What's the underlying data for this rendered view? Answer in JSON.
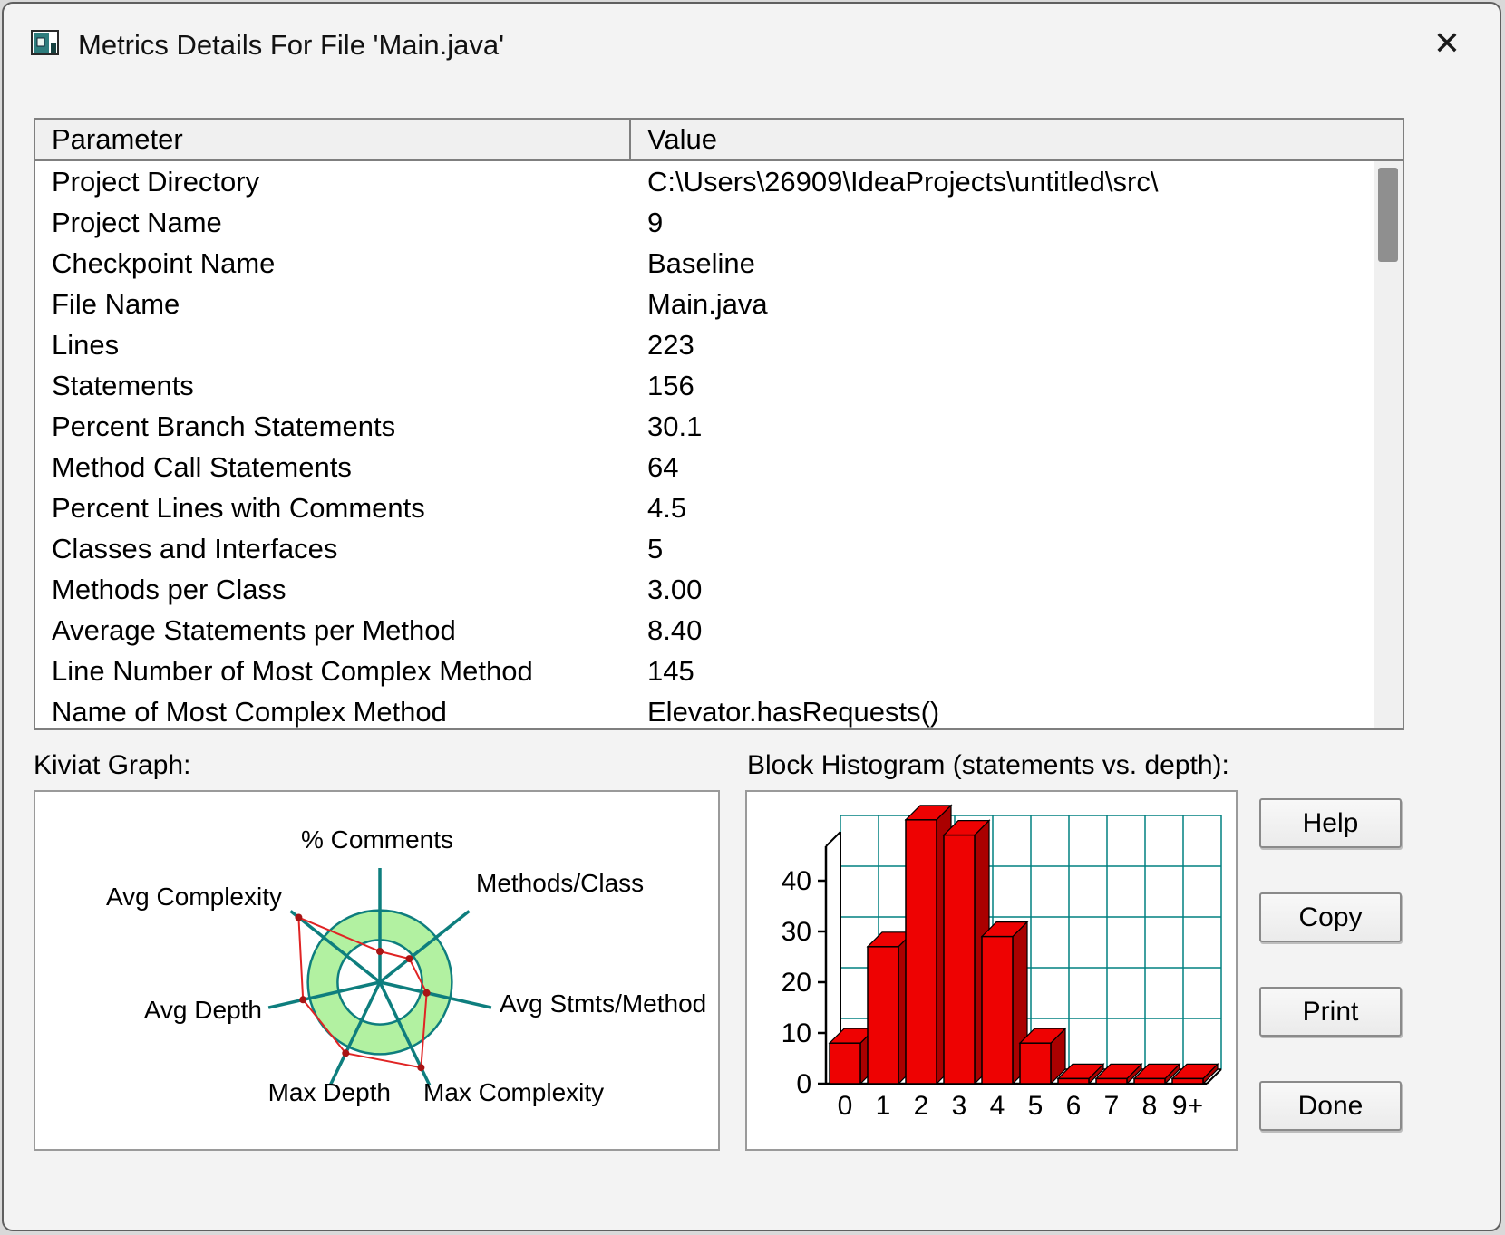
{
  "window": {
    "title": "Metrics Details For File 'Main.java'",
    "close_glyph": "✕"
  },
  "table": {
    "headers": [
      "Parameter",
      "Value"
    ],
    "rows": [
      [
        "Project Directory",
        "C:\\Users\\26909\\IdeaProjects\\untitled\\src\\"
      ],
      [
        "Project Name",
        "9"
      ],
      [
        "Checkpoint Name",
        "Baseline"
      ],
      [
        "File Name",
        "Main.java"
      ],
      [
        "Lines",
        "223"
      ],
      [
        "Statements",
        "156"
      ],
      [
        "Percent Branch Statements",
        "30.1"
      ],
      [
        "Method Call Statements",
        "64"
      ],
      [
        "Percent Lines with Comments",
        "4.5"
      ],
      [
        "Classes and Interfaces",
        "5"
      ],
      [
        "Methods per Class",
        "3.00"
      ],
      [
        "Average Statements per Method",
        "8.40"
      ],
      [
        "Line Number of Most Complex Method",
        "145"
      ],
      [
        "Name of Most Complex Method",
        "Elevator.hasRequests()"
      ]
    ]
  },
  "section_labels": {
    "kiviat": "Kiviat Graph:",
    "histogram": "Block Histogram (statements vs. depth):"
  },
  "chart_data": [
    {
      "type": "radar",
      "title": "Kiviat Graph",
      "axes": [
        "% Comments",
        "Methods/Class",
        "Avg Stmts/Method",
        "Max Complexity",
        "Max Depth",
        "Avg Depth",
        "Avg Complexity"
      ],
      "values_normalized": [
        0.27,
        0.33,
        0.42,
        0.83,
        0.69,
        0.69,
        0.91
      ],
      "normal_range_ring": [
        0.37,
        0.63
      ],
      "colors": {
        "ring_fill": "#b2f1a1",
        "axis": "#0e7e7e",
        "series": "#e02424"
      }
    },
    {
      "type": "bar",
      "title": "Block Histogram (statements vs. depth)",
      "categories": [
        "0",
        "1",
        "2",
        "3",
        "4",
        "5",
        "6",
        "7",
        "8",
        "9+"
      ],
      "values": [
        8,
        27,
        52,
        49,
        29,
        8,
        1,
        1,
        1,
        1
      ],
      "xlabel": "depth",
      "ylabel": "statements",
      "yticks": [
        0,
        10,
        20,
        30,
        40
      ],
      "ylim": [
        0,
        53
      ],
      "grid": true,
      "bar_color": "#ee0202",
      "bar_side_color": "#aa0000",
      "grid_color": "#008080"
    }
  ],
  "buttons": [
    "Help",
    "Copy",
    "Print",
    "Done"
  ]
}
